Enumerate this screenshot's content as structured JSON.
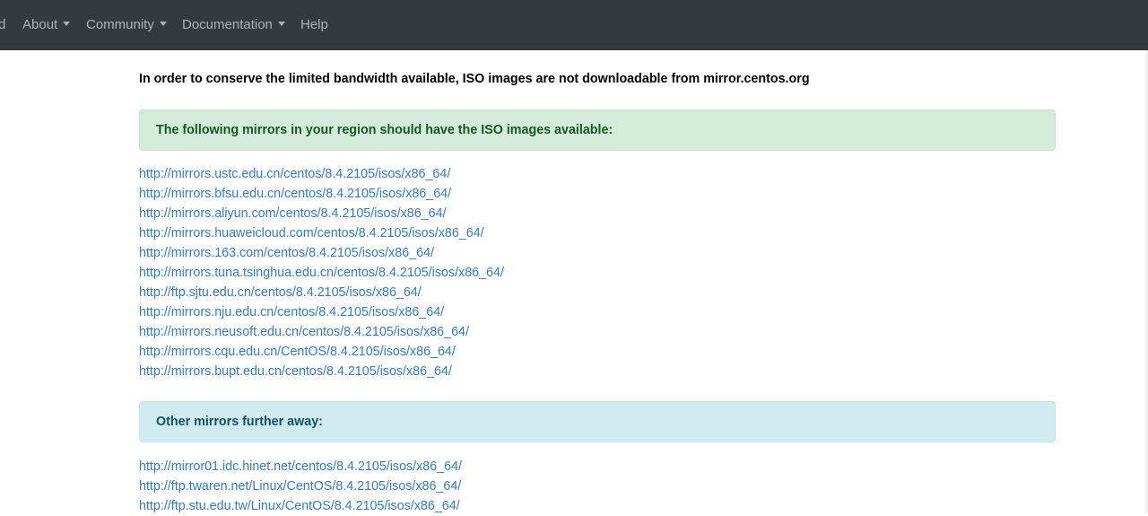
{
  "nav": {
    "items": [
      {
        "label": "d",
        "caret": false
      },
      {
        "label": "About",
        "caret": true
      },
      {
        "label": "Community",
        "caret": true
      },
      {
        "label": "Documentation",
        "caret": true
      },
      {
        "label": "Help",
        "caret": false
      }
    ]
  },
  "notice": "In order to conserve the limited bandwidth available, ISO images are not downloadable from mirror.centos.org",
  "region_heading": "The following mirrors in your region should have the ISO images available:",
  "region_mirrors": [
    "http://mirrors.ustc.edu.cn/centos/8.4.2105/isos/x86_64/",
    "http://mirrors.bfsu.edu.cn/centos/8.4.2105/isos/x86_64/",
    "http://mirrors.aliyun.com/centos/8.4.2105/isos/x86_64/",
    "http://mirrors.huaweicloud.com/centos/8.4.2105/isos/x86_64/",
    "http://mirrors.163.com/centos/8.4.2105/isos/x86_64/",
    "http://mirrors.tuna.tsinghua.edu.cn/centos/8.4.2105/isos/x86_64/",
    "http://ftp.sjtu.edu.cn/centos/8.4.2105/isos/x86_64/",
    "http://mirrors.nju.edu.cn/centos/8.4.2105/isos/x86_64/",
    "http://mirrors.neusoft.edu.cn/centos/8.4.2105/isos/x86_64/",
    "http://mirrors.cqu.edu.cn/CentOS/8.4.2105/isos/x86_64/",
    "http://mirrors.bupt.edu.cn/centos/8.4.2105/isos/x86_64/"
  ],
  "other_heading": "Other mirrors further away:",
  "other_mirrors": [
    "http://mirror01.idc.hinet.net/centos/8.4.2105/isos/x86_64/",
    "http://ftp.twaren.net/Linux/CentOS/8.4.2105/isos/x86_64/",
    "http://ftp.stu.edu.tw/Linux/CentOS/8.4.2105/isos/x86_64/"
  ]
}
